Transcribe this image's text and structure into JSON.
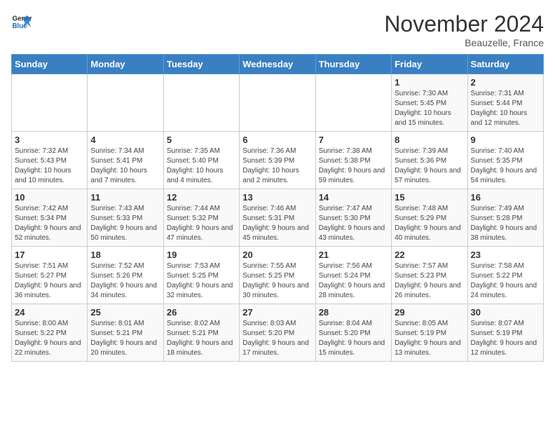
{
  "logo": {
    "general": "General",
    "blue": "Blue"
  },
  "title": "November 2024",
  "subtitle": "Beauzelle, France",
  "days_of_week": [
    "Sunday",
    "Monday",
    "Tuesday",
    "Wednesday",
    "Thursday",
    "Friday",
    "Saturday"
  ],
  "weeks": [
    [
      {
        "day": "",
        "info": ""
      },
      {
        "day": "",
        "info": ""
      },
      {
        "day": "",
        "info": ""
      },
      {
        "day": "",
        "info": ""
      },
      {
        "day": "",
        "info": ""
      },
      {
        "day": "1",
        "info": "Sunrise: 7:30 AM\nSunset: 5:45 PM\nDaylight: 10 hours and 15 minutes."
      },
      {
        "day": "2",
        "info": "Sunrise: 7:31 AM\nSunset: 5:44 PM\nDaylight: 10 hours and 12 minutes."
      }
    ],
    [
      {
        "day": "3",
        "info": "Sunrise: 7:32 AM\nSunset: 5:43 PM\nDaylight: 10 hours and 10 minutes."
      },
      {
        "day": "4",
        "info": "Sunrise: 7:34 AM\nSunset: 5:41 PM\nDaylight: 10 hours and 7 minutes."
      },
      {
        "day": "5",
        "info": "Sunrise: 7:35 AM\nSunset: 5:40 PM\nDaylight: 10 hours and 4 minutes."
      },
      {
        "day": "6",
        "info": "Sunrise: 7:36 AM\nSunset: 5:39 PM\nDaylight: 10 hours and 2 minutes."
      },
      {
        "day": "7",
        "info": "Sunrise: 7:38 AM\nSunset: 5:38 PM\nDaylight: 9 hours and 59 minutes."
      },
      {
        "day": "8",
        "info": "Sunrise: 7:39 AM\nSunset: 5:36 PM\nDaylight: 9 hours and 57 minutes."
      },
      {
        "day": "9",
        "info": "Sunrise: 7:40 AM\nSunset: 5:35 PM\nDaylight: 9 hours and 54 minutes."
      }
    ],
    [
      {
        "day": "10",
        "info": "Sunrise: 7:42 AM\nSunset: 5:34 PM\nDaylight: 9 hours and 52 minutes."
      },
      {
        "day": "11",
        "info": "Sunrise: 7:43 AM\nSunset: 5:33 PM\nDaylight: 9 hours and 50 minutes."
      },
      {
        "day": "12",
        "info": "Sunrise: 7:44 AM\nSunset: 5:32 PM\nDaylight: 9 hours and 47 minutes."
      },
      {
        "day": "13",
        "info": "Sunrise: 7:46 AM\nSunset: 5:31 PM\nDaylight: 9 hours and 45 minutes."
      },
      {
        "day": "14",
        "info": "Sunrise: 7:47 AM\nSunset: 5:30 PM\nDaylight: 9 hours and 43 minutes."
      },
      {
        "day": "15",
        "info": "Sunrise: 7:48 AM\nSunset: 5:29 PM\nDaylight: 9 hours and 40 minutes."
      },
      {
        "day": "16",
        "info": "Sunrise: 7:49 AM\nSunset: 5:28 PM\nDaylight: 9 hours and 38 minutes."
      }
    ],
    [
      {
        "day": "17",
        "info": "Sunrise: 7:51 AM\nSunset: 5:27 PM\nDaylight: 9 hours and 36 minutes."
      },
      {
        "day": "18",
        "info": "Sunrise: 7:52 AM\nSunset: 5:26 PM\nDaylight: 9 hours and 34 minutes."
      },
      {
        "day": "19",
        "info": "Sunrise: 7:53 AM\nSunset: 5:25 PM\nDaylight: 9 hours and 32 minutes."
      },
      {
        "day": "20",
        "info": "Sunrise: 7:55 AM\nSunset: 5:25 PM\nDaylight: 9 hours and 30 minutes."
      },
      {
        "day": "21",
        "info": "Sunrise: 7:56 AM\nSunset: 5:24 PM\nDaylight: 9 hours and 28 minutes."
      },
      {
        "day": "22",
        "info": "Sunrise: 7:57 AM\nSunset: 5:23 PM\nDaylight: 9 hours and 26 minutes."
      },
      {
        "day": "23",
        "info": "Sunrise: 7:58 AM\nSunset: 5:22 PM\nDaylight: 9 hours and 24 minutes."
      }
    ],
    [
      {
        "day": "24",
        "info": "Sunrise: 8:00 AM\nSunset: 5:22 PM\nDaylight: 9 hours and 22 minutes."
      },
      {
        "day": "25",
        "info": "Sunrise: 8:01 AM\nSunset: 5:21 PM\nDaylight: 9 hours and 20 minutes."
      },
      {
        "day": "26",
        "info": "Sunrise: 8:02 AM\nSunset: 5:21 PM\nDaylight: 9 hours and 18 minutes."
      },
      {
        "day": "27",
        "info": "Sunrise: 8:03 AM\nSunset: 5:20 PM\nDaylight: 9 hours and 17 minutes."
      },
      {
        "day": "28",
        "info": "Sunrise: 8:04 AM\nSunset: 5:20 PM\nDaylight: 9 hours and 15 minutes."
      },
      {
        "day": "29",
        "info": "Sunrise: 8:05 AM\nSunset: 5:19 PM\nDaylight: 9 hours and 13 minutes."
      },
      {
        "day": "30",
        "info": "Sunrise: 8:07 AM\nSunset: 5:19 PM\nDaylight: 9 hours and 12 minutes."
      }
    ]
  ]
}
